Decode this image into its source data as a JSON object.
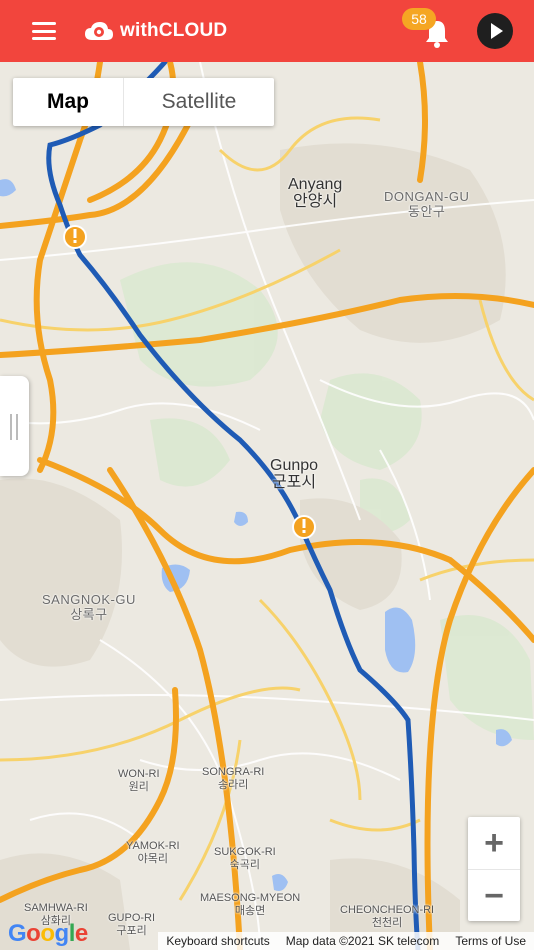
{
  "app": {
    "brand": "withCLOUD",
    "notification_count": "58",
    "icons": {
      "menu": "hamburger-icon",
      "logo": "cloud-logo-icon",
      "bell": "bell-icon",
      "play": "play-icon"
    }
  },
  "map_type": {
    "map_label": "Map",
    "satellite_label": "Satellite",
    "selected": "Map"
  },
  "zoom": {
    "in_label": "+",
    "out_label": "−"
  },
  "places": [
    {
      "key": "anyang",
      "name": "Anyang",
      "local": "안양시"
    },
    {
      "key": "dongan",
      "name": "DONGAN-GU",
      "local": "동안구"
    },
    {
      "key": "gunpo",
      "name": "Gunpo",
      "local": "군포시"
    },
    {
      "key": "sangnok",
      "name": "SANGNOK-GU",
      "local": "상록구"
    },
    {
      "key": "wonri",
      "name": "WON-RI",
      "local": "원리"
    },
    {
      "key": "songrari",
      "name": "SONGRA-RI",
      "local": "송라리"
    },
    {
      "key": "yamokri",
      "name": "YAMOK-RI",
      "local": "야목리"
    },
    {
      "key": "sukgokri",
      "name": "SUKGOK-RI",
      "local": "숙곡리"
    },
    {
      "key": "maesong",
      "name": "MAESONG-MYEON",
      "local": "매송면"
    },
    {
      "key": "samhwari",
      "name": "SAMHWA-RI",
      "local": "삼화리"
    },
    {
      "key": "gupori",
      "name": "GUPO-RI",
      "local": "구포리"
    },
    {
      "key": "cheoncheonri",
      "name": "CHEONCHEON-RI",
      "local": "천천리"
    }
  ],
  "attribution": {
    "google": "Google",
    "keyboard": "Keyboard shortcuts",
    "map_data": "Map data ©2021 SK telecom",
    "terms": "Terms of Use"
  },
  "colors": {
    "header": "#f2453d",
    "route": "#1f5bb5",
    "highway": "#f4a21f",
    "badge": "#f5a623",
    "warning": "#f4a21f"
  }
}
